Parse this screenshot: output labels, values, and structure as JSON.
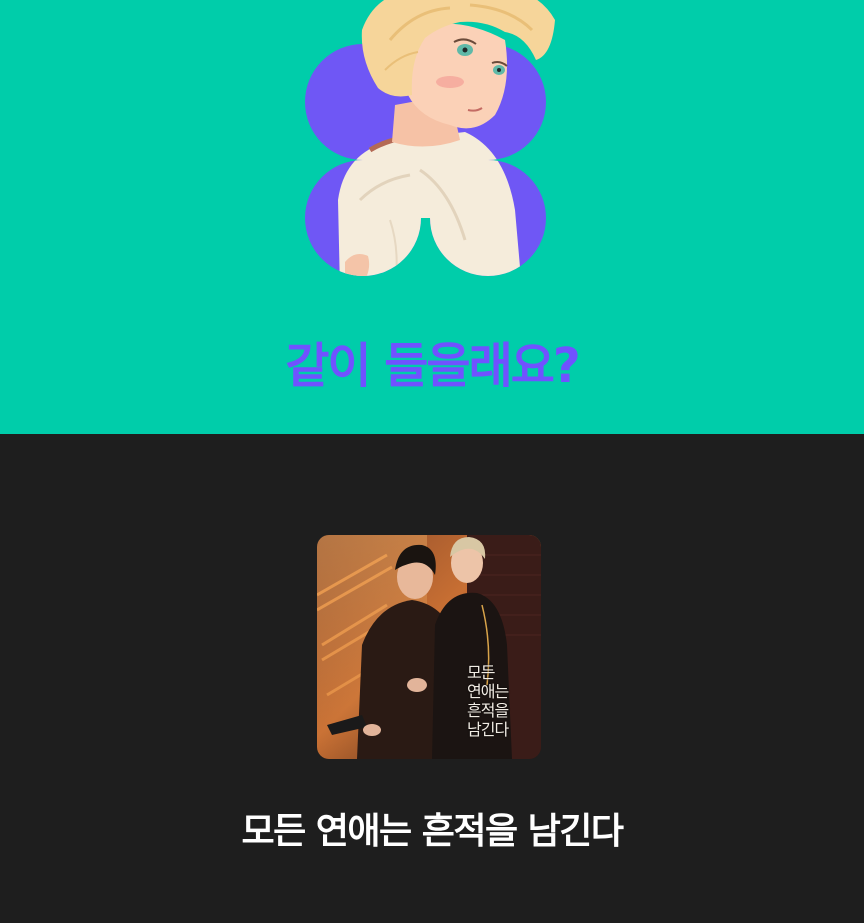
{
  "promo": {
    "title": "같이 들을래요?",
    "colors": {
      "background": "#00cdaa",
      "accent": "#7052ff"
    },
    "illustration": "blond-character-clover-illustration"
  },
  "album": {
    "title": "모든 연애는 흔적을 남긴다",
    "cover_lines": [
      "모든",
      "연애는",
      "흔적을",
      "남긴다"
    ],
    "cover_illustration": "two-men-fire-escape-artwork",
    "colors": {
      "background": "#1e1e1e",
      "text": "#ffffff"
    }
  }
}
